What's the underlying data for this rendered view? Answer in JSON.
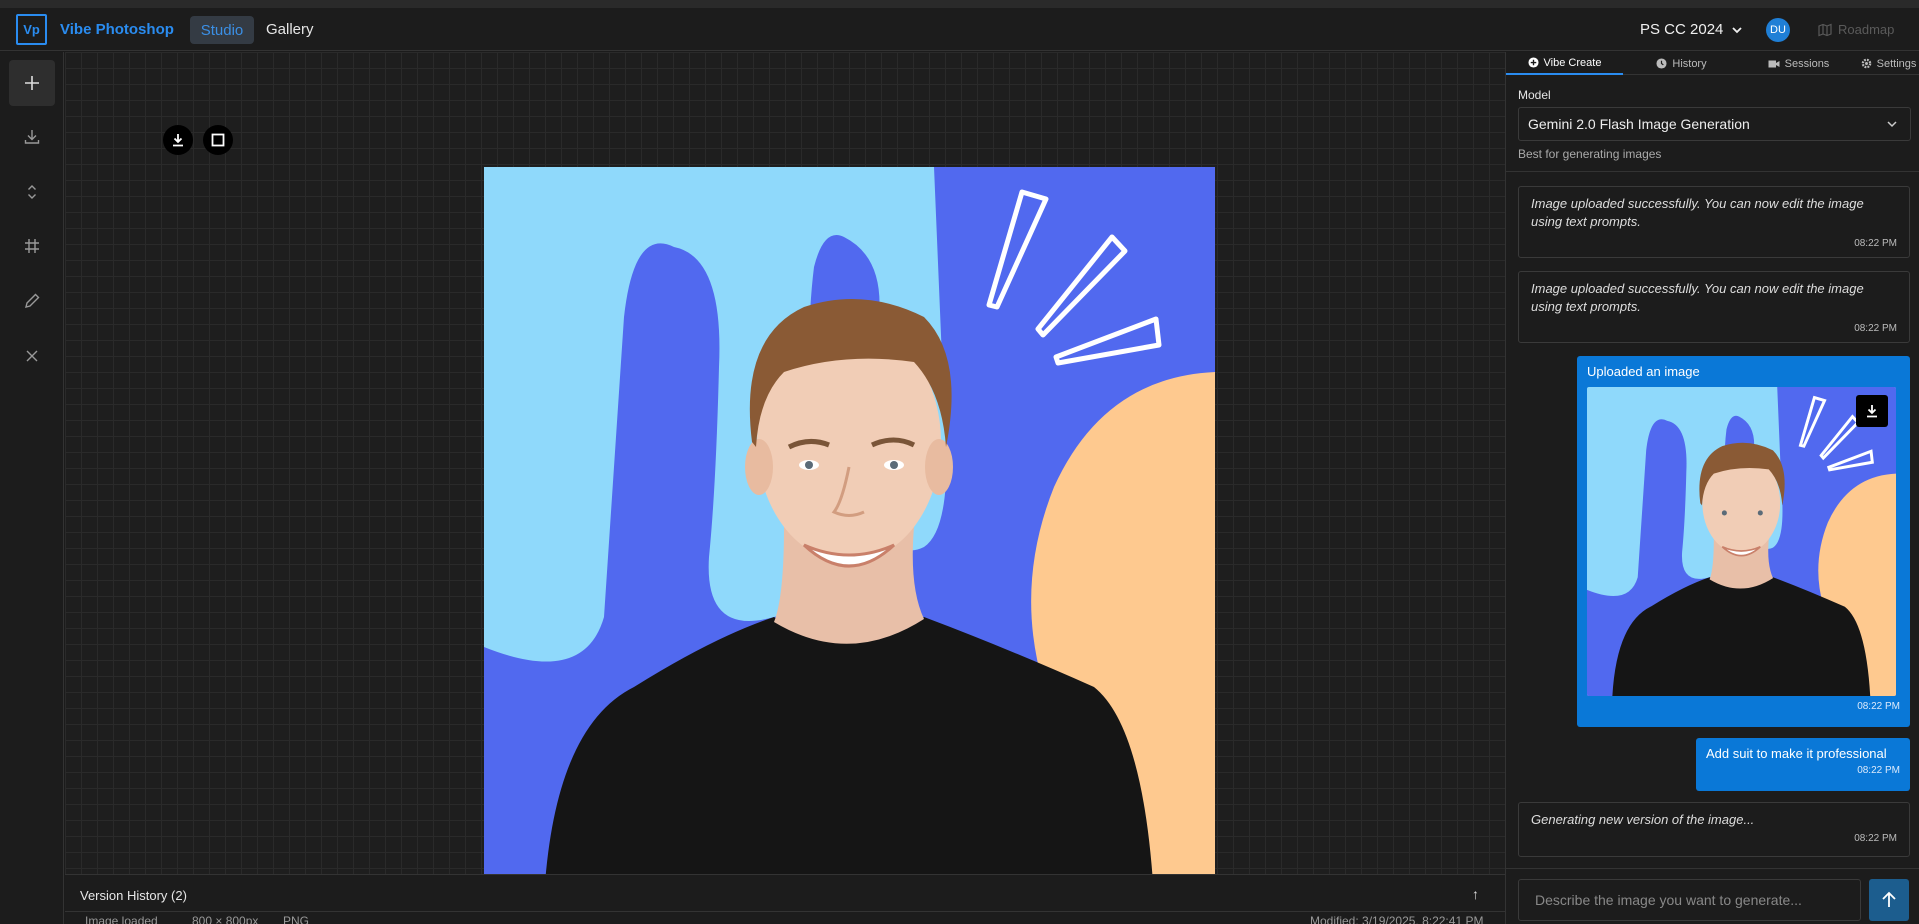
{
  "header": {
    "logo": "Vp",
    "brand": "Vibe Photoshop",
    "nav": {
      "studio": "Studio",
      "gallery": "Gallery"
    },
    "version": "PS CC 2024",
    "avatar": "DU",
    "roadmap": "Roadmap"
  },
  "toolbar": {
    "tools": [
      "plus-icon",
      "download-icon",
      "expand-icon",
      "crop-icon",
      "pencil-icon",
      "close-icon"
    ]
  },
  "canvas": {
    "image_alt": "Portrait of smiling young man in black t-shirt on colorful abstract background"
  },
  "version_history": {
    "label": "Version History (2)",
    "toggle": "↑"
  },
  "status": {
    "state": "Image loaded",
    "dimensions": "800 × 800px",
    "format": "PNG",
    "modified": "Modified: 3/19/2025, 8:22:41 PM"
  },
  "panel": {
    "tabs": [
      "Vibe Create",
      "History",
      "Sessions",
      "Settings"
    ],
    "model_label": "Model",
    "model_value": "Gemini 2.0 Flash Image Generation",
    "model_hint": "Best for generating images",
    "messages": [
      {
        "text": "Image uploaded successfully. You can now edit the image using text prompts.",
        "time": "08:22 PM"
      },
      {
        "text": "Image uploaded successfully. You can now edit the image using text prompts.",
        "time": "08:22 PM"
      },
      {
        "text": "Uploaded an image",
        "time": "08:22 PM"
      },
      {
        "text": "Add suit to make it professional",
        "time": "08:22 PM"
      },
      {
        "text": "Generating new version of the image...",
        "time": "08:22 PM"
      }
    ],
    "prompt_placeholder": "Describe the image you want to generate..."
  },
  "colors": {
    "accent": "#2a8cf0",
    "user_bubble": "#0a78d7",
    "art_light_blue": "#8fd9fb",
    "art_blue": "#5169ef",
    "art_peach": "#fec98f",
    "shirt": "#151515"
  }
}
